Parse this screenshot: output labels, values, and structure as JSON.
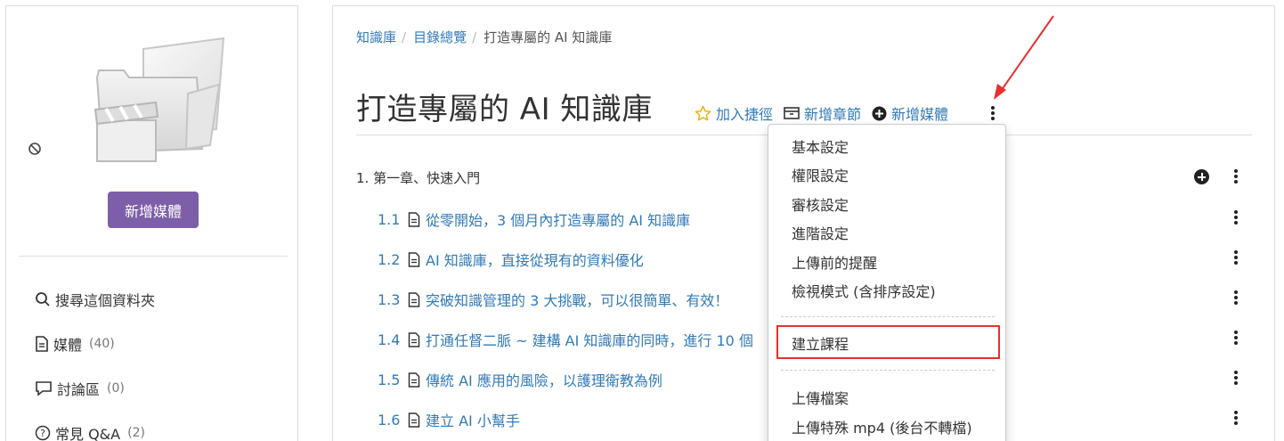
{
  "sidebar": {
    "new_media_button": "新增媒體",
    "nav": [
      {
        "label": "搜尋這個資料夾",
        "count": "",
        "icon": "search-icon"
      },
      {
        "label": "媒體",
        "count": "(40)",
        "icon": "document-icon"
      },
      {
        "label": "討論區",
        "count": "(0)",
        "icon": "comment-icon"
      },
      {
        "label": "常見 Q&A",
        "count": "(2)",
        "icon": "help-circle-icon"
      }
    ]
  },
  "breadcrumb": {
    "items": [
      "知識庫",
      "目錄總覽"
    ],
    "separator": "/",
    "current": "打造專屬的 AI 知識庫"
  },
  "page": {
    "title": "打造專屬的 AI 知識庫",
    "actions": {
      "add_shortcut": "加入捷徑",
      "add_chapter": "新增章節",
      "add_media": "新增媒體"
    }
  },
  "chapter": {
    "label": "1. 第一章、快速入門"
  },
  "sections": [
    {
      "num": "1.1",
      "title": "從零開始，3 個月內打造專屬的 AI 知識庫"
    },
    {
      "num": "1.2",
      "title": "AI 知識庫，直接從現有的資料優化"
    },
    {
      "num": "1.3",
      "title": "突破知識管理的 3 大挑戰，可以很簡單、有效！"
    },
    {
      "num": "1.4",
      "title": "打通任督二脈 ~ 建構 AI 知識庫的同時，進行 10 個"
    },
    {
      "num": "1.5",
      "title": "傳統 AI 應用的風險，以護理衛教為例"
    },
    {
      "num": "1.6",
      "title": "建立 AI 小幫手"
    }
  ],
  "dropdown": {
    "group1": [
      "基本設定",
      "權限設定",
      "審核設定",
      "進階設定",
      "上傳前的提醒",
      "檢視模式 (含排序設定)"
    ],
    "highlighted": "建立課程",
    "group3": [
      "上傳檔案",
      "上傳特殊 mp4 (後台不轉檔)"
    ]
  },
  "colors": {
    "link": "#337ab7",
    "button_purple": "#7d5ea8",
    "highlight_red": "#e8302f"
  }
}
